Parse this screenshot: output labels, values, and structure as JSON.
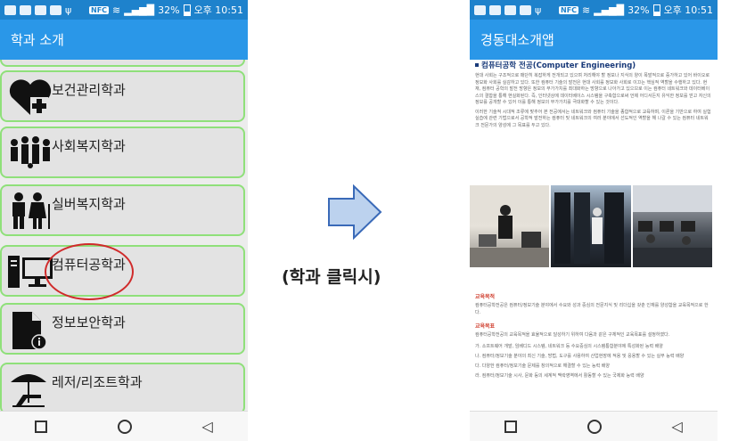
{
  "left_phone": {
    "status": {
      "battery": "32%",
      "time": "오후 10:51",
      "nfc": "NFC"
    },
    "appbar_title": "학과 소개",
    "departments": [
      {
        "label": ""
      },
      {
        "label": "보건관리학과",
        "icon": "heart-plus-icon"
      },
      {
        "label": "사회복지학과",
        "icon": "people-group-icon"
      },
      {
        "label": "실버복지학과",
        "icon": "elderly-couple-icon"
      },
      {
        "label": "컴퓨터공학과",
        "icon": "computer-icon"
      },
      {
        "label": "정보보안학과",
        "icon": "document-info-icon"
      },
      {
        "label": "레저/리조트학과",
        "icon": "beach-umbrella-icon"
      }
    ]
  },
  "middle": {
    "caption": "(학과 클릭시)",
    "arrow_color": "#bcd2ee"
  },
  "right_phone": {
    "status": {
      "battery": "32%",
      "time": "오후 10:51",
      "nfc": "NFC"
    },
    "appbar_title": "경동대소개앱",
    "doc_title": "컴퓨터공학 전공(Computer Engineering)",
    "intro_paragraph": "현대 사회는 구조적으로 매단히 복잡하게 전개되고 있으며 처리해야 할 정보나 지식의 양이 폭발적으로 증가하고 있어 바이오로 정보화 사회를 실감하고 있다. 또한 컴퓨터 기술의 발전은 현대 사회를 정보화 사회로 이끄는 핵심적 역할을 수행하고 있다. 현재, 컴퓨터 공학의 발전 방향은 정보의 부가가치를 최대화하는 방향으로 나아가고 있으므로 이는 컴퓨터 네트워크와 데이터베이스의 결합을 통해 현실화된다. 즉, 인터넷상에 데이터베이스 시스템을 구축함으로써 언제 어디서든지 유익한 정보를 얻고 자신의 정보를 공개할 수 있어 이를 통해 정보의 부가가치를 극대화할 수 있는 것이다.",
    "intro_paragraph_2": "이러한 기술적 시대적 조류에 맞추어 본 전공에서는 네트워크와 컴퓨터 기술을 종합적으로 교육하며, 이론을 기반으로 하여 실험 실습에 관련 기법으로서 공학적 발전하는 컴퓨터 및 네트워크의 여러 분야에서 선도적인 역할을 해 나갈 수 있는 컴퓨터 네트워크 전문가의 양성에 그 목표를 두고 있다.",
    "section_goal_title": "교육목적",
    "section_goal_text": "컴퓨터공학전공은 컴퓨터/정보기술 분야에서 수요와 성과 중심의 전문지식 및 리더십을 갖춘 인재를 양성함을 교육목적으로 한다.",
    "section_target_title": "교육목표",
    "section_target_intro": "컴퓨터공학전공의 교육목적을 효율적으로 달성하기 위하여 다음과 같은 구체적인 교육목표를 설정하였다.",
    "targets": [
      "가. 소프트웨어 개발, 임베디드 시스템, 네트워크 등 수요중심의 시스템통합분야에 특성화된 능력 배양",
      "나. 컴퓨터/정보기술 분야의 최신 기술, 방법, 도구를 사용하여 산업현장에 적용 및 응용할 수 있는 실무 능력 배양",
      "다. 다양한 컴퓨터/정보기술 문제를 창의적으로 해결할 수 있는 능력 배양",
      "라. 컴퓨터/정보기술 시사, 문화 등의 세계적 맥락영역에서 활동할 수 있는 국제화 능력 배양"
    ]
  },
  "colors": {
    "status_bar": "#1e82cc",
    "app_bar": "#2a97e8",
    "card_border": "#8fe07a",
    "highlight_circle": "#d02b2b"
  }
}
